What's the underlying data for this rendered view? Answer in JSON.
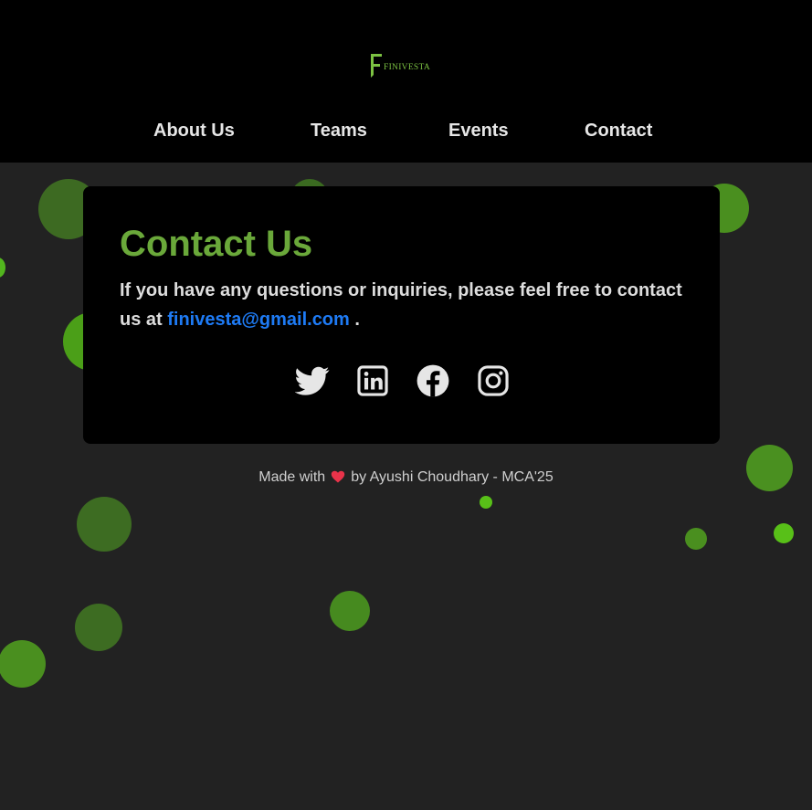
{
  "logo": {
    "text": "FINIVESTA",
    "icon": "flag-logo-icon"
  },
  "nav": {
    "items": [
      {
        "label": "About Us"
      },
      {
        "label": "Teams"
      },
      {
        "label": "Events"
      },
      {
        "label": "Contact"
      }
    ]
  },
  "contact": {
    "title": "Contact Us",
    "text_before": "If you have any questions or inquiries, please feel free to contact us at",
    "email": "finivesta@gmail.com",
    "text_after": ".",
    "socials": [
      "twitter-icon",
      "linkedin-icon",
      "facebook-icon",
      "instagram-icon"
    ]
  },
  "footer": {
    "made_with": "Made with",
    "by_line": "by Ayushi Choudhary - MCA'25"
  },
  "colors": {
    "background": "#222222",
    "header": "#000000",
    "accent_green": "#6aa83a",
    "link_blue": "#1e7bf5",
    "heart_red": "#e8334a"
  }
}
